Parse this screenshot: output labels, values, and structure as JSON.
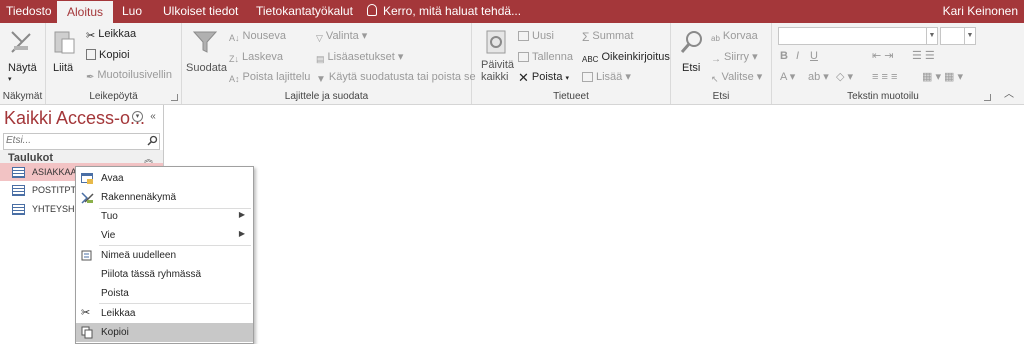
{
  "tabs": [
    "Tiedosto",
    "Aloitus",
    "Luo",
    "Ulkoiset tiedot",
    "Tietokantatyökalut"
  ],
  "tell_me": "Kerro, mitä haluat tehdä...",
  "user_name": "Kari Keinonen",
  "ribbon": {
    "nakymat": {
      "view_label": "Näytä",
      "group_label": "Näkymät"
    },
    "leikepoyta": {
      "paste_label": "Liitä",
      "cut_label": "Leikkaa",
      "copy_label": "Kopioi",
      "format_painter_label": "Muotoilusivellin",
      "group_label": "Leikepöytä"
    },
    "lajittele": {
      "filter_label": "Suodata",
      "ascending_label": "Nouseva",
      "descending_label": "Laskeva",
      "remove_sort_label": "Poista lajittelu",
      "selection_label": "Valinta",
      "advanced_label": "Lisäasetukset",
      "toggle_filter_label": "Käytä suodatusta tai poista se",
      "group_label": "Lajittele ja suodata"
    },
    "tietueet": {
      "refresh_label": "Päivitä kaikki",
      "new_label": "Uusi",
      "save_label": "Tallenna",
      "delete_label": "Poista",
      "totals_label": "Summat",
      "spelling_label": "Oikeinkirjoitus",
      "more_label": "Lisää",
      "group_label": "Tietueet"
    },
    "etsi": {
      "find_label": "Etsi",
      "replace_label": "Korvaa",
      "goto_label": "Siirry",
      "select_label": "Valitse",
      "group_label": "Etsi"
    },
    "tekstin_muotoilu": {
      "group_label": "Tekstin muotoilu"
    }
  },
  "nav": {
    "title": "Kaikki Access-o...",
    "search_placeholder": "Etsi...",
    "section": "Taulukot",
    "items": [
      "ASIAKKAAT",
      "POSTITPT",
      "YHTEYSHEN"
    ]
  },
  "context_menu": [
    "Avaa",
    "Rakennenäkymä",
    "Tuo",
    "Vie",
    "Nimeä uudelleen",
    "Piilota tässä ryhmässä",
    "Poista",
    "Leikkaa",
    "Kopioi"
  ],
  "colors": {
    "accent": "#a4373a",
    "selection": "#f2c3c4"
  }
}
